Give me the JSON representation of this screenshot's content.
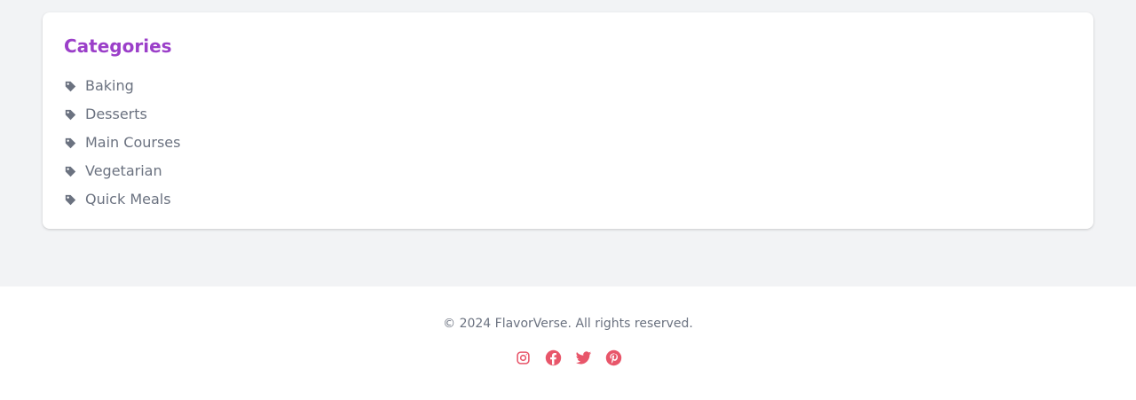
{
  "categories": {
    "title": "Categories",
    "items": [
      {
        "label": "Baking",
        "icon": "tag-icon"
      },
      {
        "label": "Desserts",
        "icon": "tag-icon"
      },
      {
        "label": "Main Courses",
        "icon": "tag-icon"
      },
      {
        "label": "Vegetarian",
        "icon": "tag-icon"
      },
      {
        "label": "Quick Meals",
        "icon": "tag-icon"
      }
    ]
  },
  "footer": {
    "copyright": "© 2024 FlavorVerse. All rights reserved.",
    "social": [
      {
        "icon": "instagram-icon"
      },
      {
        "icon": "facebook-icon"
      },
      {
        "icon": "twitter-icon"
      },
      {
        "icon": "pinterest-icon"
      }
    ]
  },
  "colors": {
    "accent": "#9b3fc9",
    "text_muted": "#6b7280",
    "social": "#e8566a",
    "page_bg": "#f2f3f5"
  }
}
